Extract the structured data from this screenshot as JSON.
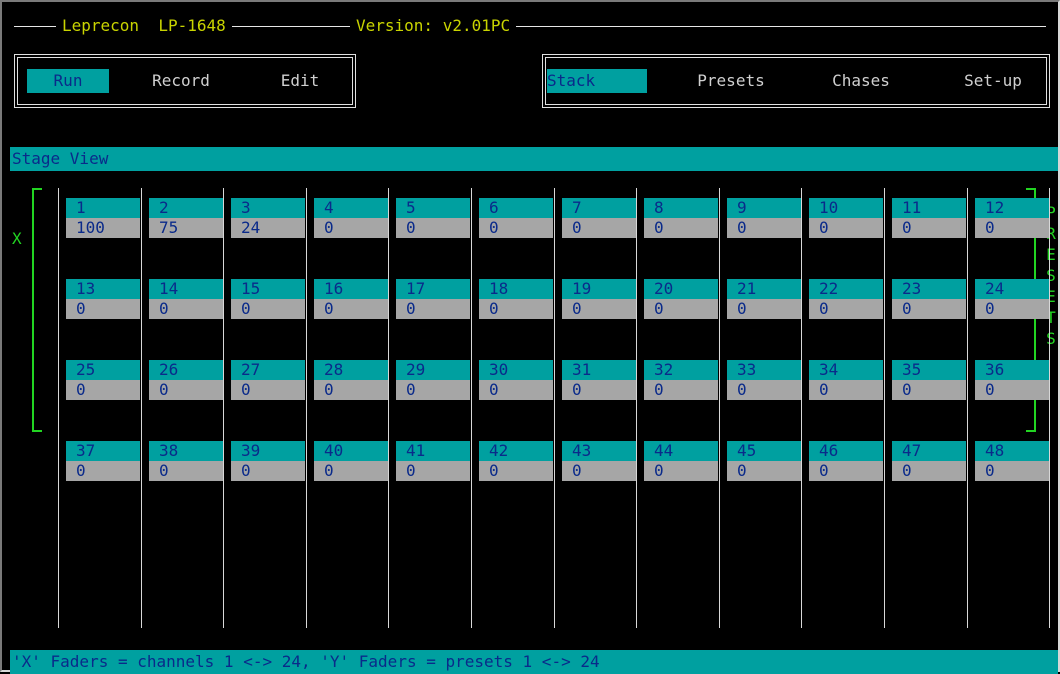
{
  "title": {
    "app": "Leprecon  LP-1648",
    "version": "Version: v2.01PC"
  },
  "left_menu": [
    {
      "label": "Run",
      "active": true
    },
    {
      "label": "Record",
      "active": false
    },
    {
      "label": "Edit",
      "active": false
    }
  ],
  "right_menu": [
    {
      "label": "Stack",
      "active": true
    },
    {
      "label": "Presets",
      "active": false
    },
    {
      "label": "Chases",
      "active": false
    },
    {
      "label": "Set-up",
      "active": false
    }
  ],
  "stage_view": {
    "label": "Stage View",
    "x_label": "X",
    "presets_label": [
      "P",
      "R",
      "E",
      "S",
      "E",
      "T",
      "S"
    ]
  },
  "channels": [
    {
      "num": "1",
      "val": "100"
    },
    {
      "num": "2",
      "val": "75"
    },
    {
      "num": "3",
      "val": "24"
    },
    {
      "num": "4",
      "val": "0"
    },
    {
      "num": "5",
      "val": "0"
    },
    {
      "num": "6",
      "val": "0"
    },
    {
      "num": "7",
      "val": "0"
    },
    {
      "num": "8",
      "val": "0"
    },
    {
      "num": "9",
      "val": "0"
    },
    {
      "num": "10",
      "val": "0"
    },
    {
      "num": "11",
      "val": "0"
    },
    {
      "num": "12",
      "val": "0"
    },
    {
      "num": "13",
      "val": "0"
    },
    {
      "num": "14",
      "val": "0"
    },
    {
      "num": "15",
      "val": "0"
    },
    {
      "num": "16",
      "val": "0"
    },
    {
      "num": "17",
      "val": "0"
    },
    {
      "num": "18",
      "val": "0"
    },
    {
      "num": "19",
      "val": "0"
    },
    {
      "num": "20",
      "val": "0"
    },
    {
      "num": "21",
      "val": "0"
    },
    {
      "num": "22",
      "val": "0"
    },
    {
      "num": "23",
      "val": "0"
    },
    {
      "num": "24",
      "val": "0"
    },
    {
      "num": "25",
      "val": "0"
    },
    {
      "num": "26",
      "val": "0"
    },
    {
      "num": "27",
      "val": "0"
    },
    {
      "num": "28",
      "val": "0"
    },
    {
      "num": "29",
      "val": "0"
    },
    {
      "num": "30",
      "val": "0"
    },
    {
      "num": "31",
      "val": "0"
    },
    {
      "num": "32",
      "val": "0"
    },
    {
      "num": "33",
      "val": "0"
    },
    {
      "num": "34",
      "val": "0"
    },
    {
      "num": "35",
      "val": "0"
    },
    {
      "num": "36",
      "val": "0"
    },
    {
      "num": "37",
      "val": "0"
    },
    {
      "num": "38",
      "val": "0"
    },
    {
      "num": "39",
      "val": "0"
    },
    {
      "num": "40",
      "val": "0"
    },
    {
      "num": "41",
      "val": "0"
    },
    {
      "num": "42",
      "val": "0"
    },
    {
      "num": "43",
      "val": "0"
    },
    {
      "num": "44",
      "val": "0"
    },
    {
      "num": "45",
      "val": "0"
    },
    {
      "num": "46",
      "val": "0"
    },
    {
      "num": "47",
      "val": "0"
    },
    {
      "num": "48",
      "val": "0"
    }
  ],
  "status_bar": "'X' Faders = channels 1 <-> 24, 'Y' Faders = presets 1 <-> 24",
  "colors": {
    "teal": "#00a0a0",
    "grey": "#a6a6a6",
    "text_blue": "#0a2a8a",
    "title_yellow": "#c9d400",
    "bracket_green": "#22d422"
  }
}
